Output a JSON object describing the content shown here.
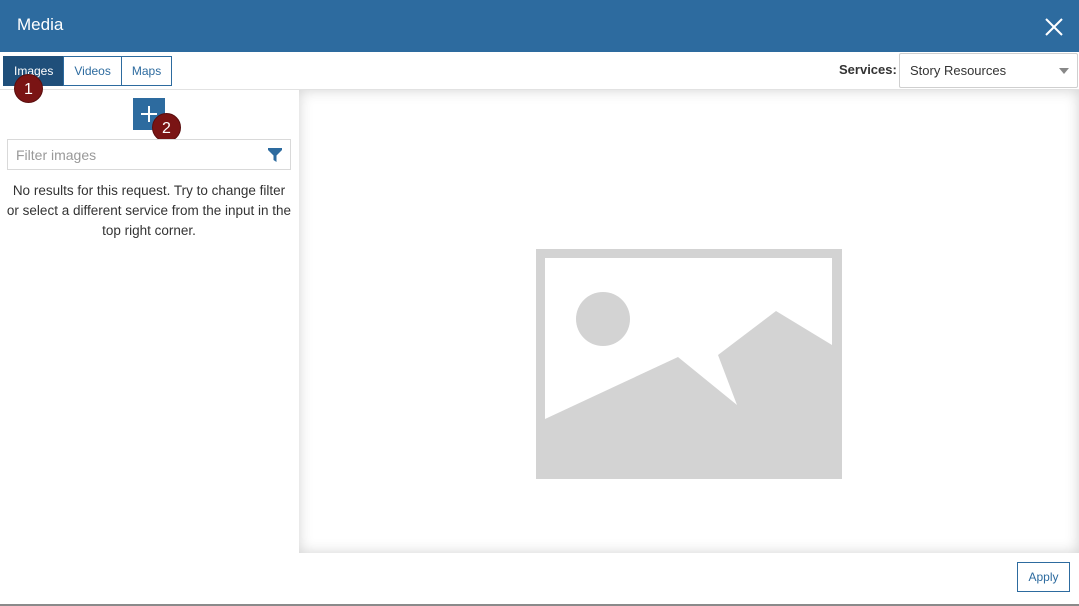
{
  "dialog": {
    "title": "Media",
    "close_icon": "close-icon"
  },
  "tabs": [
    {
      "label": "Images",
      "active": true
    },
    {
      "label": "Videos",
      "active": false
    },
    {
      "label": "Maps",
      "active": false
    }
  ],
  "services": {
    "label": "Services:",
    "value": "Story Resources"
  },
  "badges": [
    "1",
    "2"
  ],
  "sidebar": {
    "add_icon": "plus-icon",
    "filter_placeholder": "Filter images",
    "filter_icon": "funnel-icon",
    "no_results": "No results for this request. Try to change filter or select a different service from the input in the top right corner."
  },
  "preview": {
    "placeholder_icon": "image-placeholder-icon"
  },
  "footer": {
    "apply_label": "Apply"
  },
  "colors": {
    "header": "#2d6b9f",
    "active_tab": "#1f4f7a",
    "badge": "#7a1414",
    "placeholder_gray": "#d3d3d3"
  }
}
